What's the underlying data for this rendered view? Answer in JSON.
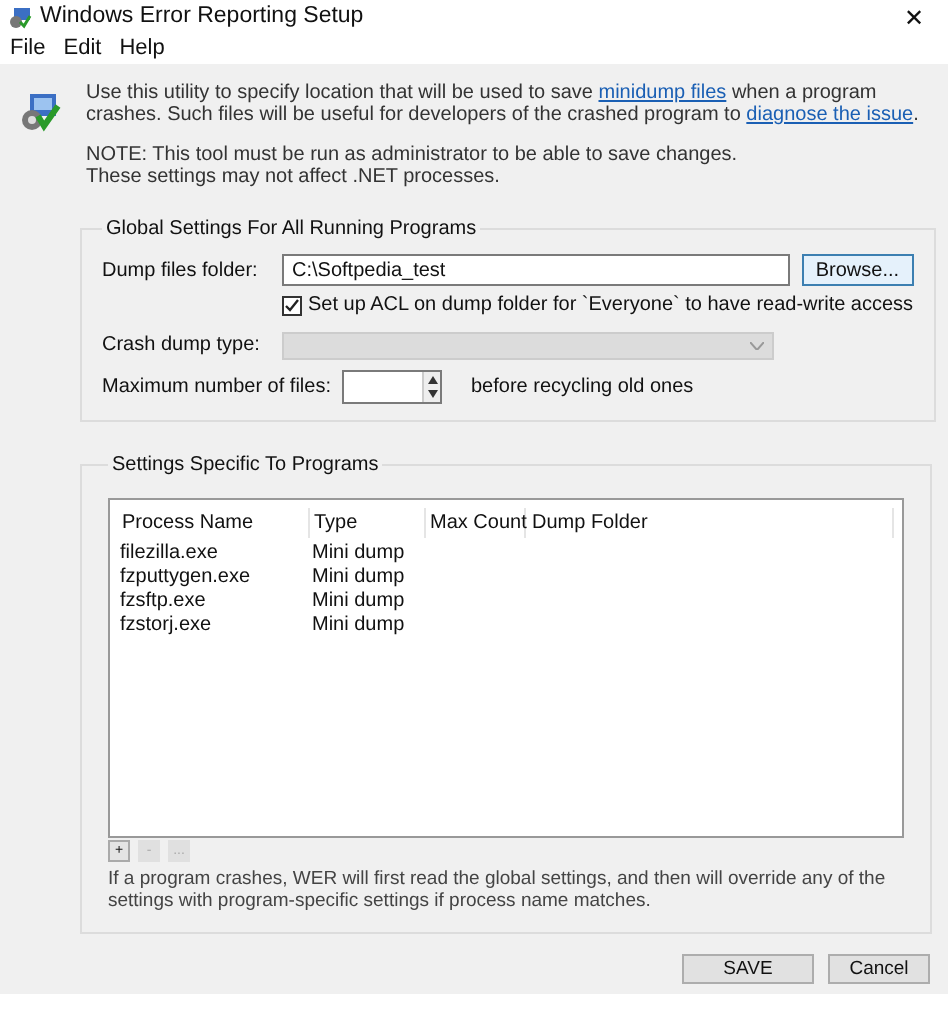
{
  "window": {
    "title": "Windows Error Reporting Setup",
    "close": "✕"
  },
  "menu": [
    "File",
    "Edit",
    "Help"
  ],
  "intro": {
    "before": "Use this utility to specify location that will be used to save ",
    "link1": "minidump files",
    "middle": " when a program crashes. Such files will be useful for developers of the crashed program to ",
    "link2": "diagnose the issue",
    "after": "."
  },
  "note": [
    "NOTE: This tool must be run as administrator to be able to save changes.",
    "These settings may not affect .NET processes."
  ],
  "global": {
    "title": "Global Settings For All Running Programs",
    "folder_label": "Dump files folder:",
    "folder_value": "C:\\Softpedia_test",
    "browse": "Browse...",
    "acl": {
      "label": "Set up ACL on dump folder for `Everyone` to have read-write access",
      "checked": true
    },
    "crash_label": "Crash dump type:",
    "crash_disabled": true,
    "max_label": "Maximum number of files:",
    "max_suffix": "before recycling old ones"
  },
  "specific": {
    "title": "Settings Specific To Programs",
    "columns": [
      "Process Name",
      "Type",
      "Max Count",
      "Dump Folder"
    ],
    "rows": [
      [
        "filezilla.exe",
        "Mini dump"
      ],
      [
        "fzputtygen.exe",
        "Mini dump"
      ],
      [
        "fzsftp.exe",
        "Mini dump"
      ],
      [
        "fzstorj.exe",
        "Mini dump"
      ]
    ],
    "tools": [
      {
        "label": "+",
        "disabled": false
      },
      {
        "label": "-",
        "disabled": true
      },
      {
        "label": "...",
        "disabled": true
      }
    ],
    "hint": "If a program crashes, WER will first read the global settings, and then will override any of the settings with program-specific settings if process name matches."
  },
  "buttons": [
    "SAVE",
    "Cancel"
  ]
}
